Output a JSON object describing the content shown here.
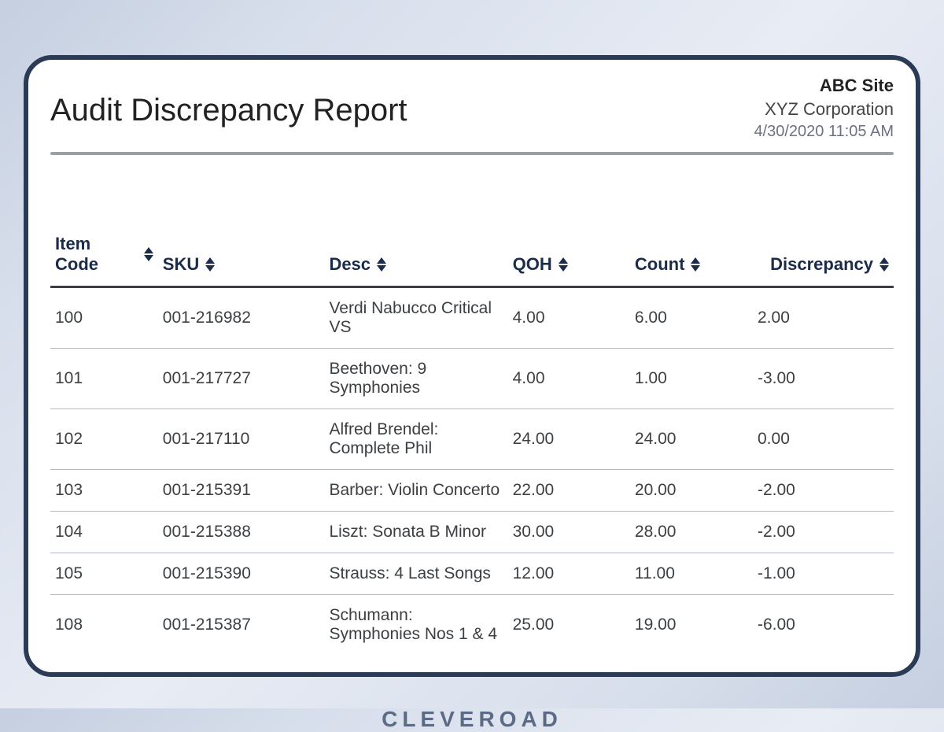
{
  "report": {
    "title": "Audit Discrepancy Report",
    "site": "ABC Site",
    "company": "XYZ Corporation",
    "timestamp": "4/30/2020 11:05 AM"
  },
  "columns": {
    "item_code": "Item Code",
    "sku": "SKU",
    "desc": "Desc",
    "qoh": "QOH",
    "count": "Count",
    "discrepancy": "Discrepancy"
  },
  "rows": [
    {
      "item_code": "100",
      "sku": "001-216982",
      "desc": "Verdi Nabucco Critical VS",
      "qoh": "4.00",
      "count": "6.00",
      "discrepancy": "2.00"
    },
    {
      "item_code": "101",
      "sku": "001-217727",
      "desc": "Beethoven: 9 Symphonies",
      "qoh": "4.00",
      "count": "1.00",
      "discrepancy": "-3.00"
    },
    {
      "item_code": "102",
      "sku": "001-217110",
      "desc": "Alfred Brendel: Complete Phil",
      "qoh": "24.00",
      "count": "24.00",
      "discrepancy": "0.00"
    },
    {
      "item_code": "103",
      "sku": "001-215391",
      "desc": "Barber: Violin Concerto",
      "qoh": "22.00",
      "count": "20.00",
      "discrepancy": "-2.00"
    },
    {
      "item_code": "104",
      "sku": "001-215388",
      "desc": "Liszt: Sonata B Minor",
      "qoh": "30.00",
      "count": "28.00",
      "discrepancy": "-2.00"
    },
    {
      "item_code": "105",
      "sku": "001-215390",
      "desc": "Strauss: 4 Last Songs",
      "qoh": "12.00",
      "count": "11.00",
      "discrepancy": "-1.00"
    },
    {
      "item_code": "108",
      "sku": "001-215387",
      "desc": "Schumann: Symphonies Nos 1 & 4",
      "qoh": "25.00",
      "count": "19.00",
      "discrepancy": "-6.00"
    }
  ],
  "brand": "CLEVEROAD"
}
